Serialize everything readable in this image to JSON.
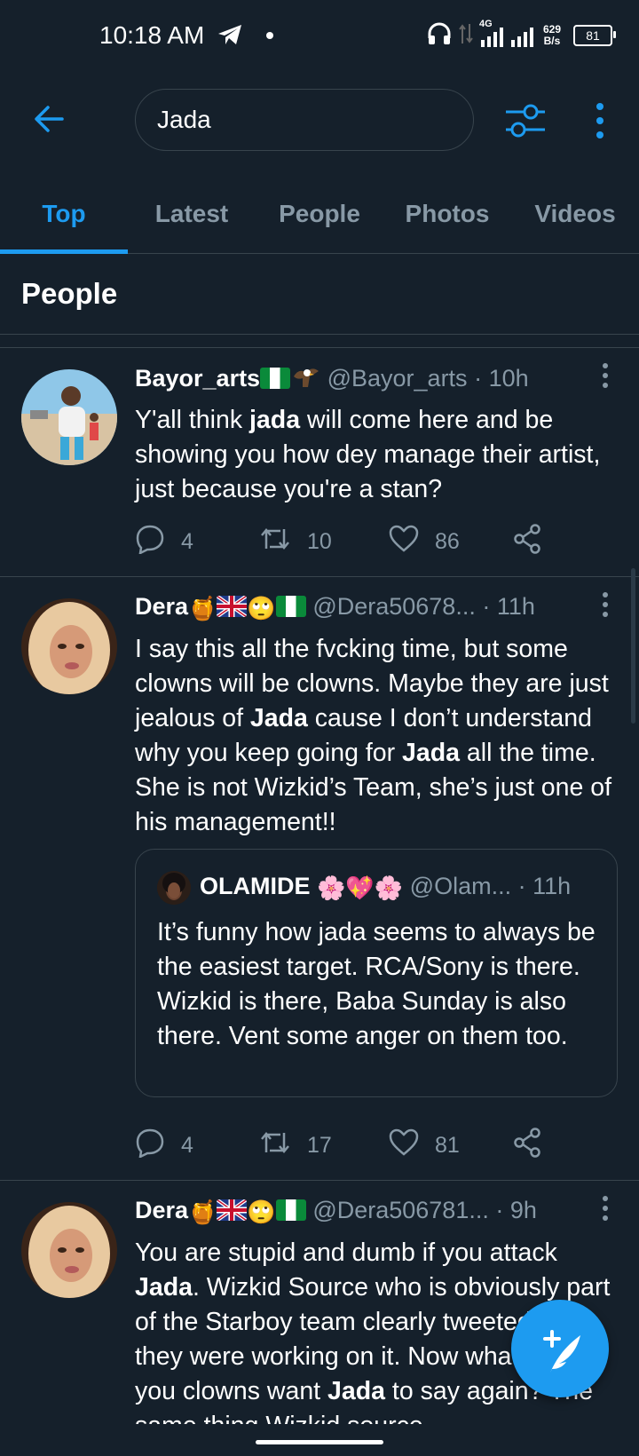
{
  "status_bar": {
    "time": "10:18 AM",
    "network_type": "4G",
    "data_rate_value": "629",
    "data_rate_unit": "B/s",
    "battery": "81"
  },
  "search": {
    "query": "Jada"
  },
  "tabs": [
    {
      "label": "Top",
      "active": true
    },
    {
      "label": "Latest",
      "active": false
    },
    {
      "label": "People",
      "active": false
    },
    {
      "label": "Photos",
      "active": false
    },
    {
      "label": "Videos",
      "active": false
    }
  ],
  "section": {
    "title": "People"
  },
  "tweets": [
    {
      "name": "Bayor_arts",
      "handle": "@Bayor_arts",
      "time": "· 10h",
      "text_parts": [
        "Y'all think ",
        "jada",
        " will come here and be showing you how dey manage their artist, just because you're a stan?"
      ],
      "replies": "4",
      "retweets": "10",
      "likes": "86"
    },
    {
      "name": "Dera",
      "handle": "@Dera50678...",
      "time": "· 11h",
      "text_parts": [
        "I say this all the fvcking time, but some clowns will be clowns. Maybe they are just jealous of ",
        "Jada",
        " cause I don’t understand why you keep going for ",
        "Jada",
        " all the time. She is not Wizkid’s Team, she’s just one of his management!!"
      ],
      "quote": {
        "name": "OLAMIDE",
        "handle": "@Olam...",
        "time": "· 11h",
        "text": "It’s funny how jada seems to always be the easiest target. RCA/Sony is there. Wizkid is there, Baba Sunday is also there. Vent some anger on them too."
      },
      "replies": "4",
      "retweets": "17",
      "likes": "81"
    },
    {
      "name": "Dera",
      "handle": "@Dera506781...",
      "time": "· 9h",
      "text_parts": [
        "You are stupid and dumb if you attack ",
        "Jada",
        ". Wizkid Source who is obviously part of the Starboy team clearly tweeted that they were working on it. Now what else do you clowns want ",
        "Jada",
        " to say again? The same thing Wizkid source"
      ]
    }
  ],
  "colors": {
    "background": "#15202b",
    "accent": "#1d9bf0",
    "muted": "#8899a6",
    "divider": "#38444d"
  }
}
